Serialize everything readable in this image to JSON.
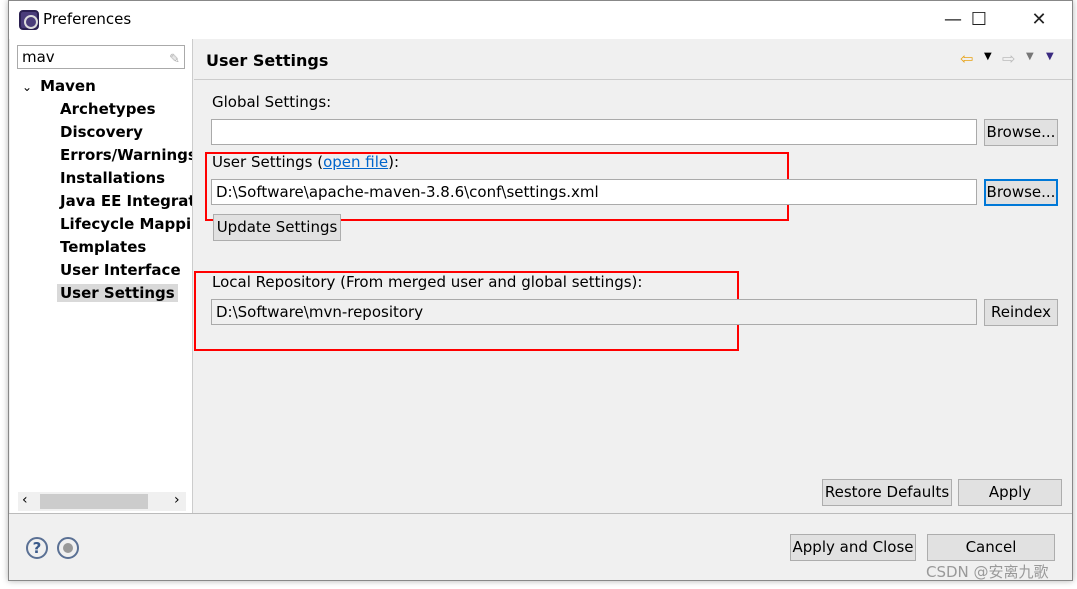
{
  "window": {
    "title": "Preferences",
    "minimize": "—",
    "maximize": "☐",
    "close": "✕"
  },
  "sidebar": {
    "filter_value": "mav",
    "root": "Maven",
    "items": [
      {
        "label": "Archetypes"
      },
      {
        "label": "Discovery"
      },
      {
        "label": "Errors/Warnings"
      },
      {
        "label": "Installations"
      },
      {
        "label": "Java EE Integration"
      },
      {
        "label": "Lifecycle Mappings"
      },
      {
        "label": "Templates"
      },
      {
        "label": "User Interface"
      },
      {
        "label": "User Settings",
        "selected": true
      }
    ]
  },
  "page": {
    "title": "User Settings",
    "global_label": "Global Settings:",
    "global_value": "",
    "browse": "Browse...",
    "user_label_pre": "User Settings (",
    "open_file": "open file",
    "user_label_post": "):",
    "user_value": "D:\\Software\\apache-maven-3.8.6\\conf\\settings.xml",
    "update": "Update Settings",
    "local_label": "Local Repository (From merged user and global settings):",
    "local_value": "D:\\Software\\mvn-repository",
    "reindex": "Reindex",
    "restore": "Restore Defaults",
    "apply": "Apply"
  },
  "footer": {
    "apply_close": "Apply and Close",
    "cancel": "Cancel"
  },
  "watermark": "CSDN @安离九歌",
  "colors": {
    "highlight": "#ff0000",
    "link": "#0066cc",
    "back_arrow": "#e8a317"
  }
}
